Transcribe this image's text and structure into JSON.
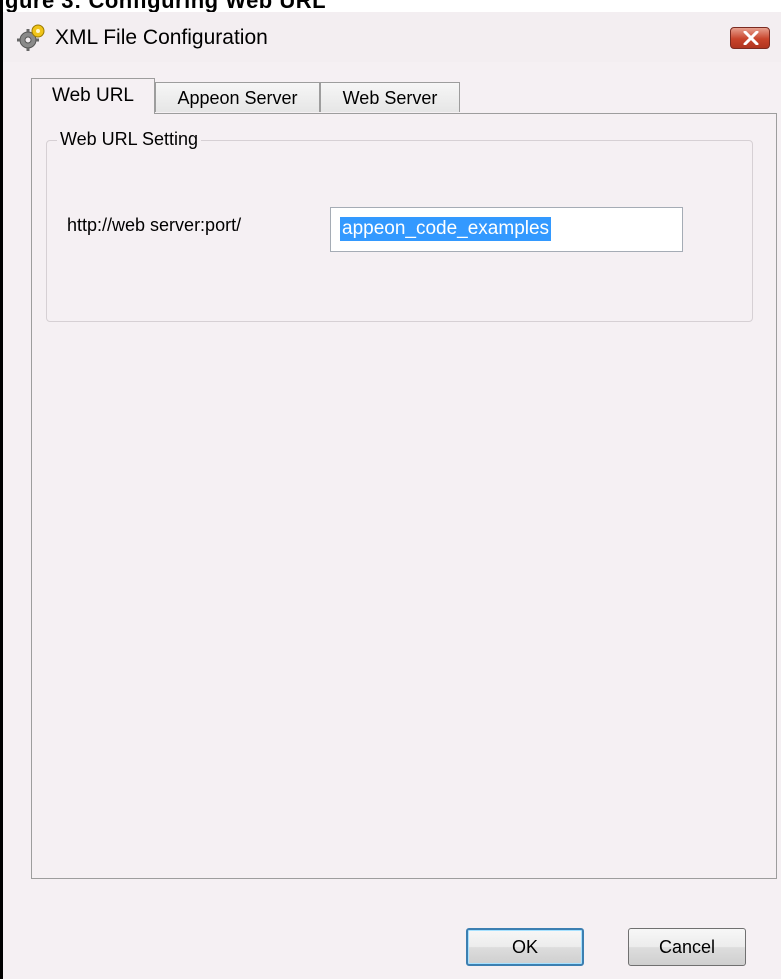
{
  "caption_partial": "gure 3: Configuring Web URL",
  "window": {
    "title": "XML File Configuration",
    "icon": "gear-icon",
    "close_icon": "close-icon"
  },
  "tabs": [
    {
      "label": "Web URL",
      "active": true
    },
    {
      "label": "Appeon Server",
      "active": false
    },
    {
      "label": "Web Server",
      "active": false
    }
  ],
  "group": {
    "label": "Web URL Setting",
    "url_prefix": "http://web server:port/",
    "url_value": "appeon_code_examples"
  },
  "buttons": {
    "ok": "OK",
    "cancel": "Cancel"
  },
  "colors": {
    "selection": "#3399ff",
    "close_button": "#c8442b",
    "window_bg": "#f5f0f3"
  }
}
